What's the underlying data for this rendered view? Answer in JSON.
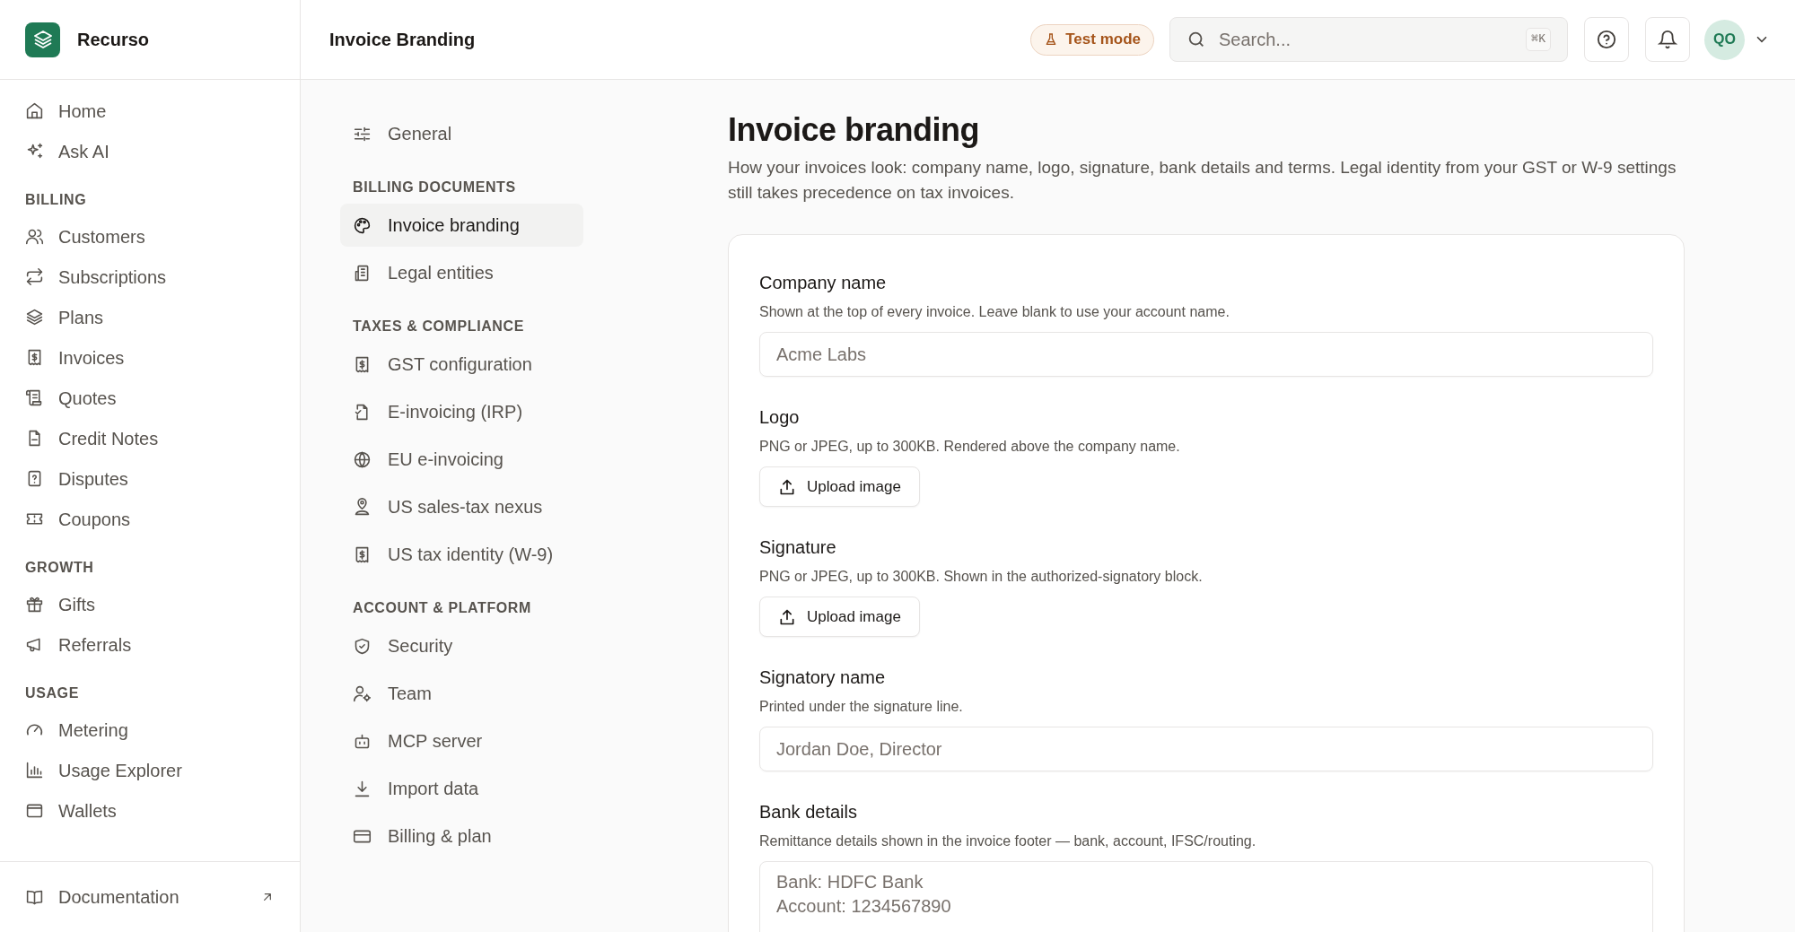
{
  "app": {
    "name": "Recurso"
  },
  "sidebar": {
    "groups": [
      {
        "items": [
          {
            "label": "Home",
            "selected": false
          },
          {
            "label": "Ask AI",
            "selected": false
          }
        ]
      },
      {
        "heading": "BILLING",
        "items": [
          {
            "label": "Customers",
            "selected": false
          },
          {
            "label": "Subscriptions",
            "selected": false
          },
          {
            "label": "Plans",
            "selected": false
          },
          {
            "label": "Invoices",
            "selected": false
          },
          {
            "label": "Quotes",
            "selected": false
          },
          {
            "label": "Credit Notes",
            "selected": false
          },
          {
            "label": "Disputes",
            "selected": false
          },
          {
            "label": "Coupons",
            "selected": false
          }
        ]
      },
      {
        "heading": "GROWTH",
        "items": [
          {
            "label": "Gifts",
            "selected": false
          },
          {
            "label": "Referrals",
            "selected": false
          }
        ]
      },
      {
        "heading": "USAGE",
        "items": [
          {
            "label": "Metering",
            "selected": false
          },
          {
            "label": "Usage Explorer",
            "selected": false
          },
          {
            "label": "Wallets",
            "selected": false
          }
        ]
      }
    ],
    "footer": {
      "label": "Documentation"
    }
  },
  "header": {
    "title": "Invoice Branding",
    "test_mode": "Test mode",
    "search": {
      "placeholder": "Search...",
      "shortcut": "⌘K"
    },
    "avatar": "QO"
  },
  "settings_nav": {
    "groups": [
      {
        "items": [
          {
            "label": "General",
            "selected": false
          }
        ]
      },
      {
        "heading": "BILLING DOCUMENTS",
        "items": [
          {
            "label": "Invoice branding",
            "selected": true
          },
          {
            "label": "Legal entities",
            "selected": false
          }
        ]
      },
      {
        "heading": "TAXES & COMPLIANCE",
        "items": [
          {
            "label": "GST configuration",
            "selected": false
          },
          {
            "label": "E-invoicing (IRP)",
            "selected": false
          },
          {
            "label": "EU e-invoicing",
            "selected": false
          },
          {
            "label": "US sales-tax nexus",
            "selected": false
          },
          {
            "label": "US tax identity (W-9)",
            "selected": false
          }
        ]
      },
      {
        "heading": "ACCOUNT & PLATFORM",
        "items": [
          {
            "label": "Security",
            "selected": false
          },
          {
            "label": "Team",
            "selected": false
          },
          {
            "label": "MCP server",
            "selected": false
          },
          {
            "label": "Import data",
            "selected": false
          },
          {
            "label": "Billing & plan",
            "selected": false
          }
        ]
      }
    ]
  },
  "page": {
    "title": "Invoice branding",
    "description": "How your invoices look: company name, logo, signature, bank details and terms. Legal identity from your GST or W-9 settings still takes precedence on tax invoices.",
    "fields": [
      {
        "kind": "input",
        "label": "Company name",
        "hint": "Shown at the top of every invoice. Leave blank to use your account name.",
        "placeholder": "Acme Labs"
      },
      {
        "kind": "upload",
        "label": "Logo",
        "hint": "PNG or JPEG, up to 300KB. Rendered above the company name.",
        "button": "Upload image"
      },
      {
        "kind": "upload",
        "label": "Signature",
        "hint": "PNG or JPEG, up to 300KB. Shown in the authorized-signatory block.",
        "button": "Upload image"
      },
      {
        "kind": "input",
        "label": "Signatory name",
        "hint": "Printed under the signature line.",
        "placeholder": "Jordan Doe, Director"
      },
      {
        "kind": "textarea",
        "label": "Bank details",
        "hint": "Remittance details shown in the invoice footer — bank, account, IFSC/routing.",
        "placeholder": "Bank: HDFC Bank\nAccount: 1234567890"
      }
    ]
  }
}
